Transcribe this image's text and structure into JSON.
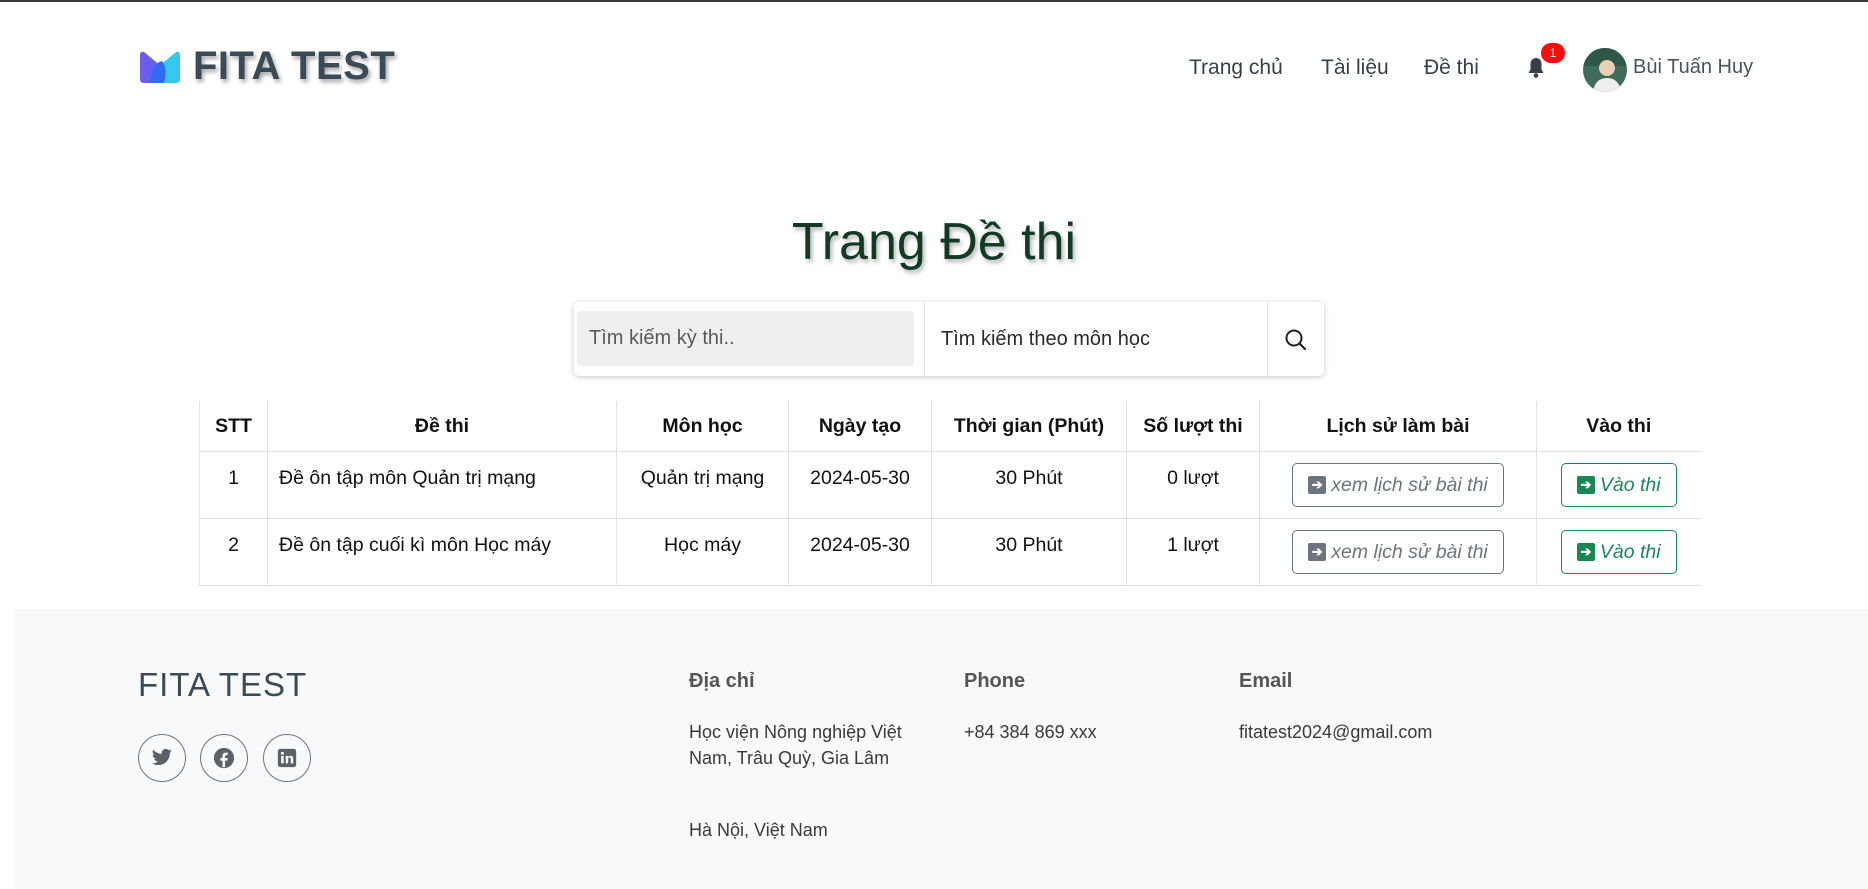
{
  "header": {
    "brand": "FITA TEST",
    "nav": [
      {
        "label": "Trang chủ"
      },
      {
        "label": "Tài liệu"
      },
      {
        "label": "Đề thi"
      }
    ],
    "notification_count": "1",
    "user_name": "Bùi Tuấn Huy"
  },
  "page_title": "Trang Đề thi",
  "search": {
    "keyword_placeholder": "Tìm kiếm kỳ thi..",
    "subject_value": "Tìm kiếm theo môn học"
  },
  "table": {
    "columns": [
      "STT",
      "Đề thi",
      "Môn học",
      "Ngày tạo",
      "Thời gian (Phút)",
      "Số lượt thi",
      "Lịch sử làm bài",
      "Vào thi"
    ],
    "rows": [
      {
        "stt": "1",
        "name": "Đề ôn tập môn Quản trị mạng",
        "subject": "Quản trị mạng",
        "created": "2024-05-30",
        "duration": "30 Phút",
        "attempts": "0 lượt",
        "history_label": "xem lịch sử bài thi",
        "enter_label": "Vào thi"
      },
      {
        "stt": "2",
        "name": "Đề ôn tập cuối kì môn Học máy",
        "subject": "Học máy",
        "created": "2024-05-30",
        "duration": "30 Phút",
        "attempts": "1 lượt",
        "history_label": "xem lịch sử bài thi",
        "enter_label": "Vào thi"
      }
    ]
  },
  "footer": {
    "brand": "FITA TEST",
    "address_title": "Địa chỉ",
    "address_line1": "Học viện Nông nghiệp Việt",
    "address_line2": "Nam, Trâu Quỳ, Gia Lâm",
    "address_line3": "Hà Nội, Việt Nam",
    "phone_title": "Phone",
    "phone": "+84 384 869 xxx",
    "email_title": "Email",
    "email": "fitatest2024@gmail.com",
    "social_icons": [
      "twitter-icon",
      "facebook-icon",
      "linkedin-icon"
    ]
  },
  "colors": {
    "success": "#198754",
    "secondary": "#6c757d",
    "badge": "#f70d0d",
    "title": "#123a25"
  }
}
